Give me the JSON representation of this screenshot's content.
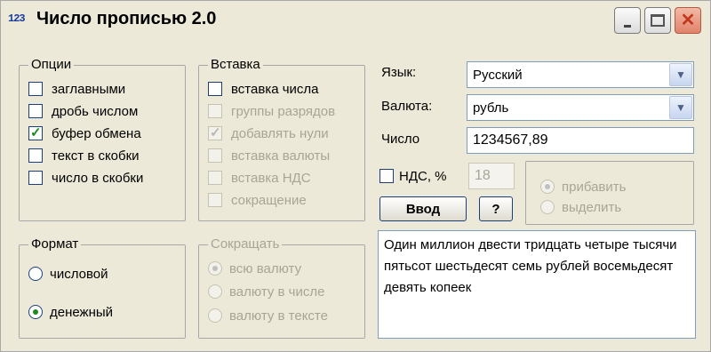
{
  "window": {
    "icon": "123",
    "title": "Число прописью 2.0",
    "minimize_label": "m",
    "close_glyph": "✕"
  },
  "options": {
    "title": "Опции",
    "items": [
      {
        "label": "заглавными",
        "checked": false
      },
      {
        "label": "дробь числом",
        "checked": false
      },
      {
        "label": "буфер обмена",
        "checked": true
      },
      {
        "label": "текст в скобки",
        "checked": false
      },
      {
        "label": "число в скобки",
        "checked": false
      }
    ]
  },
  "insert": {
    "title": "Вставка",
    "items": [
      {
        "label": "вставка числа",
        "checked": false,
        "enabled": true
      },
      {
        "label": "группы разрядов",
        "checked": false,
        "enabled": false
      },
      {
        "label": "добавлять нули",
        "checked": true,
        "enabled": false
      },
      {
        "label": "вставка валюты",
        "checked": false,
        "enabled": false
      },
      {
        "label": "вставка НДС",
        "checked": false,
        "enabled": false
      },
      {
        "label": "сокращение",
        "checked": false,
        "enabled": false
      }
    ]
  },
  "format": {
    "title": "Формат",
    "items": [
      {
        "label": "числовой",
        "selected": false
      },
      {
        "label": "денежный",
        "selected": true
      }
    ]
  },
  "abbrev": {
    "title": "Сокращать",
    "items": [
      {
        "label": "всю валюту",
        "selected": true
      },
      {
        "label": "валюту в числе",
        "selected": false
      },
      {
        "label": "валюту в тексте",
        "selected": false
      }
    ]
  },
  "settings": {
    "language_label": "Язык:",
    "language_value": "Русский",
    "currency_label": "Валюта:",
    "currency_value": "рубль",
    "number_label": "Число",
    "number_value": "1234567,89",
    "vat_label": "НДС, %",
    "vat_checked": false,
    "vat_value": "18",
    "vat_options": [
      {
        "label": "прибавить",
        "selected": true
      },
      {
        "label": "выделить",
        "selected": false
      }
    ]
  },
  "buttons": {
    "enter_label": "Ввод",
    "help_label": "?"
  },
  "result": {
    "text": "Один миллион двести тридцать четыре тысячи пятьсот шестьдесят семь рублей восемьдесят девять копеек"
  }
}
